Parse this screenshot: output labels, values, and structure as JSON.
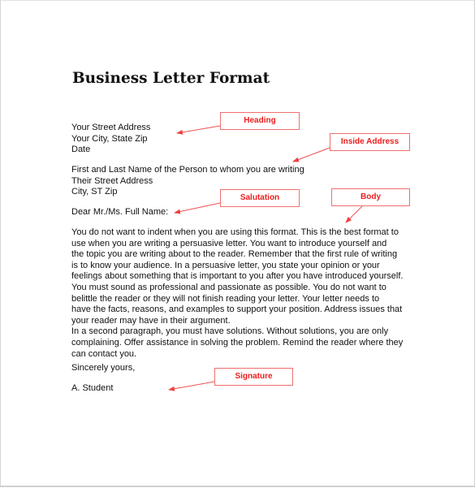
{
  "document": {
    "title": "Business Letter Format",
    "heading_lines": [
      "Your Street Address",
      "Your City, State  Zip",
      "Date"
    ],
    "inside_address_lines": [
      "First and Last Name of the Person to whom you are writing",
      "Their Street Address",
      "City, ST Zip"
    ],
    "salutation": "Dear Mr./Ms. Full Name:",
    "body_lines": [
      "You do not want to indent when you are using this format.  This is the best format to",
      "use when you are writing a persuasive letter.    You want to introduce yourself and",
      "the topic you are writing about to the reader.  Remember that the first rule of writing",
      "is to know your audience.  In a persuasive letter, you state your opinion or your",
      "feelings about something that is important to you after you have introduced yourself.",
      "You must sound as professional and passionate as possible.  You do not want to",
      "belittle the reader or they will not finish reading your letter.  Your letter needs to",
      "have the facts, reasons, and examples to support your position. Address issues that",
      "your reader may have in their argument.",
      "In a second paragraph, you must have solutions.  Without solutions, you are only",
      "complaining. Offer assistance in solving the problem.  Remind the reader where they",
      "can contact you."
    ],
    "closing": "Sincerely yours,",
    "signature": "A. Student"
  },
  "callouts": {
    "heading": "Heading",
    "inside_address": "Inside Address",
    "salutation": "Salutation",
    "body": "Body",
    "signature": "Signature"
  },
  "colors": {
    "callout_text": "#ee1c1c",
    "callout_border": "#f07070",
    "arrow": "#f05050"
  }
}
